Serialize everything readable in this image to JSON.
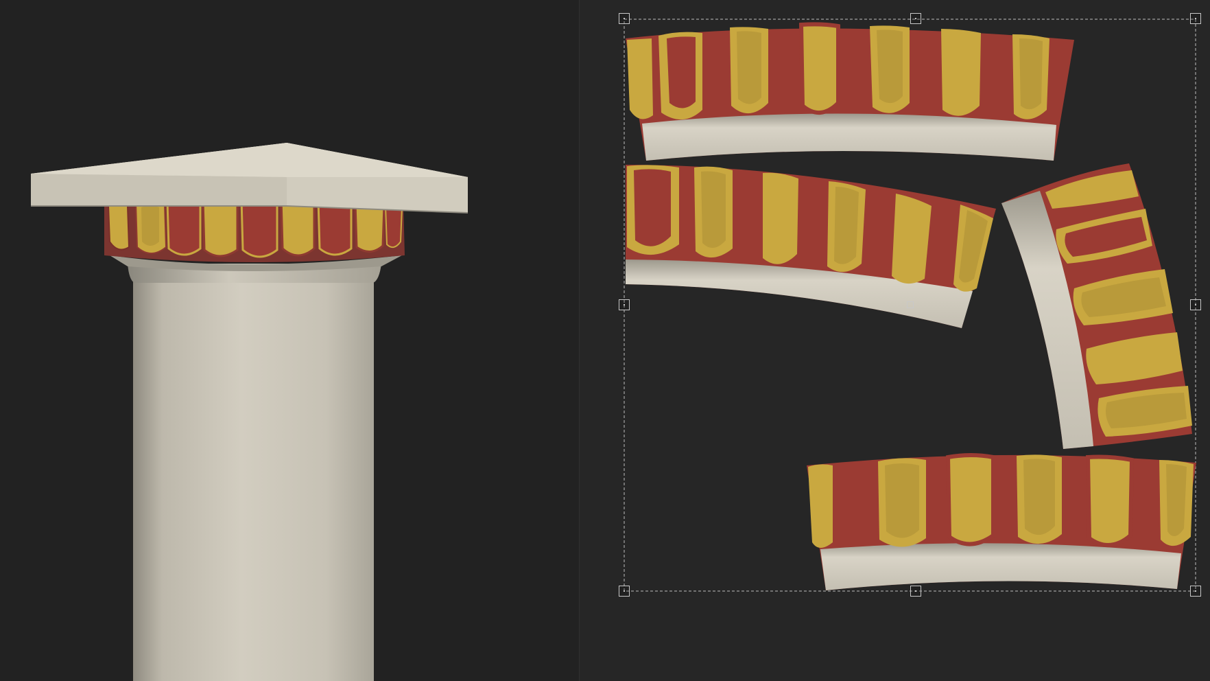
{
  "app": {
    "left_viewport": "3d-preview",
    "right_viewport": "uv-editor"
  },
  "scene": {
    "object": "column",
    "parts": [
      "abacus",
      "echinus-egg-band",
      "necking",
      "shaft"
    ]
  },
  "uv_editor": {
    "islands": [
      {
        "id": "island-top",
        "tongues": 7
      },
      {
        "id": "island-middle",
        "tongues": 6
      },
      {
        "id": "island-rotated",
        "tongues": 5
      },
      {
        "id": "island-bottom",
        "tongues": 6
      }
    ],
    "selection": {
      "handles": [
        "top-left",
        "top-center",
        "top-right",
        "middle-left",
        "middle-right",
        "bottom-left",
        "bottom-center",
        "bottom-right"
      ],
      "pivot": "center"
    }
  },
  "colors": {
    "background": "#222222",
    "uv_background": "#262626",
    "stone": "#cfcabb",
    "stone_shadow": "#9a968a",
    "tongue_red": "#9b3b33",
    "tongue_gold": "#c9a840",
    "selection": "#c8c8c8"
  }
}
